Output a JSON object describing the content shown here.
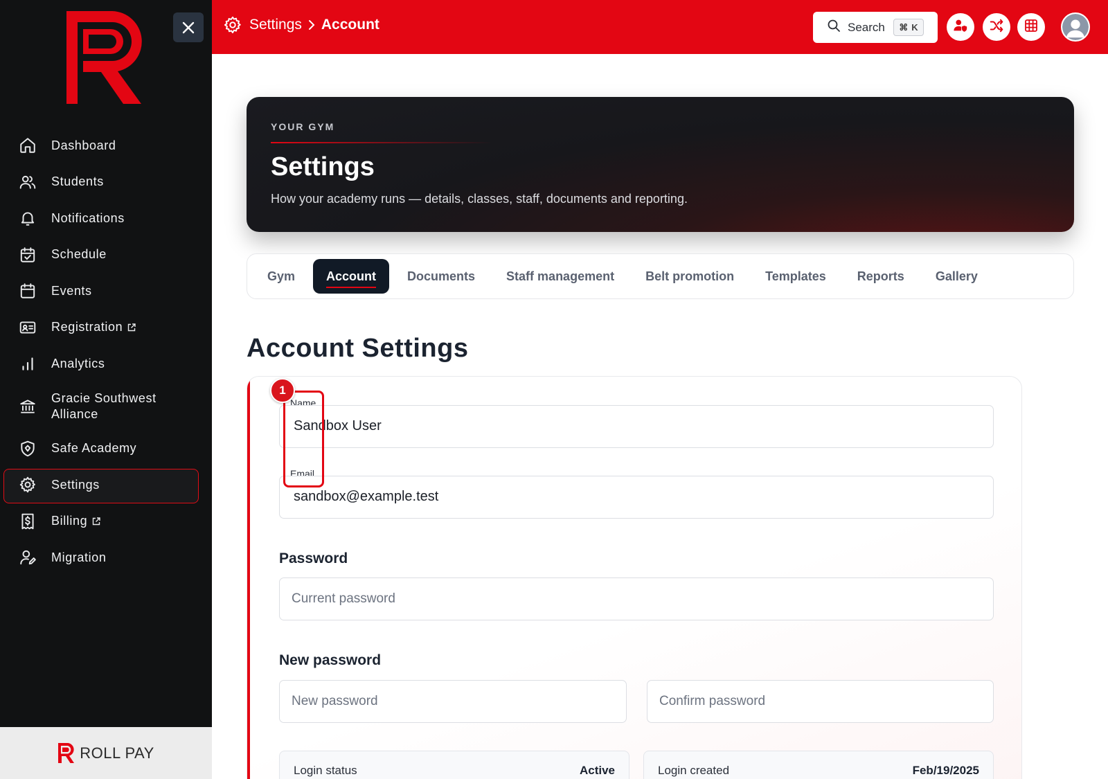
{
  "brand": {
    "footer_text": "ROLL PAY"
  },
  "sidebar": {
    "items": [
      {
        "label": "Dashboard",
        "icon": "home-icon"
      },
      {
        "label": "Students",
        "icon": "users-icon"
      },
      {
        "label": "Notifications",
        "icon": "bell-icon"
      },
      {
        "label": "Schedule",
        "icon": "calendar-check-icon"
      },
      {
        "label": "Events",
        "icon": "calendar-icon"
      },
      {
        "label": "Registration",
        "icon": "id-card-icon",
        "external": true
      },
      {
        "label": "Analytics",
        "icon": "bar-chart-icon"
      },
      {
        "label": "Gracie Southwest Alliance",
        "icon": "bank-icon"
      },
      {
        "label": "Safe Academy",
        "icon": "shield-icon"
      },
      {
        "label": "Settings",
        "icon": "gear-icon",
        "active": true
      },
      {
        "label": "Billing",
        "icon": "receipt-dollar-icon",
        "external": true
      },
      {
        "label": "Migration",
        "icon": "user-edit-icon"
      }
    ]
  },
  "topbar": {
    "breadcrumb_root": "Settings",
    "breadcrumb_current": "Account",
    "search_label": "Search",
    "search_shortcut_mod": "⌘",
    "search_shortcut_key": "K"
  },
  "hero": {
    "eyebrow": "YOUR GYM",
    "title": "Settings",
    "description": "How your academy runs — details, classes, staff, documents and reporting."
  },
  "tabs": [
    {
      "label": "Gym"
    },
    {
      "label": "Account",
      "active": true
    },
    {
      "label": "Documents"
    },
    {
      "label": "Staff management"
    },
    {
      "label": "Belt promotion"
    },
    {
      "label": "Templates"
    },
    {
      "label": "Reports"
    },
    {
      "label": "Gallery"
    }
  ],
  "account": {
    "section_title": "Account Settings",
    "name_label": "Name",
    "name_value": "Sandbox User",
    "email_label": "Email",
    "email_value": "sandbox@example.test",
    "password_heading": "Password",
    "current_password_placeholder": "Current password",
    "new_password_heading": "New password",
    "new_password_placeholder": "New password",
    "confirm_password_placeholder": "Confirm password",
    "login_status_label": "Login status",
    "login_status_value": "Active",
    "login_created_label": "Login created",
    "login_created_value": "Feb/19/2025"
  },
  "annotation": {
    "badge": "1"
  },
  "colors": {
    "brand_red": "#e30613",
    "sidebar_bg": "#111213",
    "active_tab_bg": "#111a26"
  }
}
